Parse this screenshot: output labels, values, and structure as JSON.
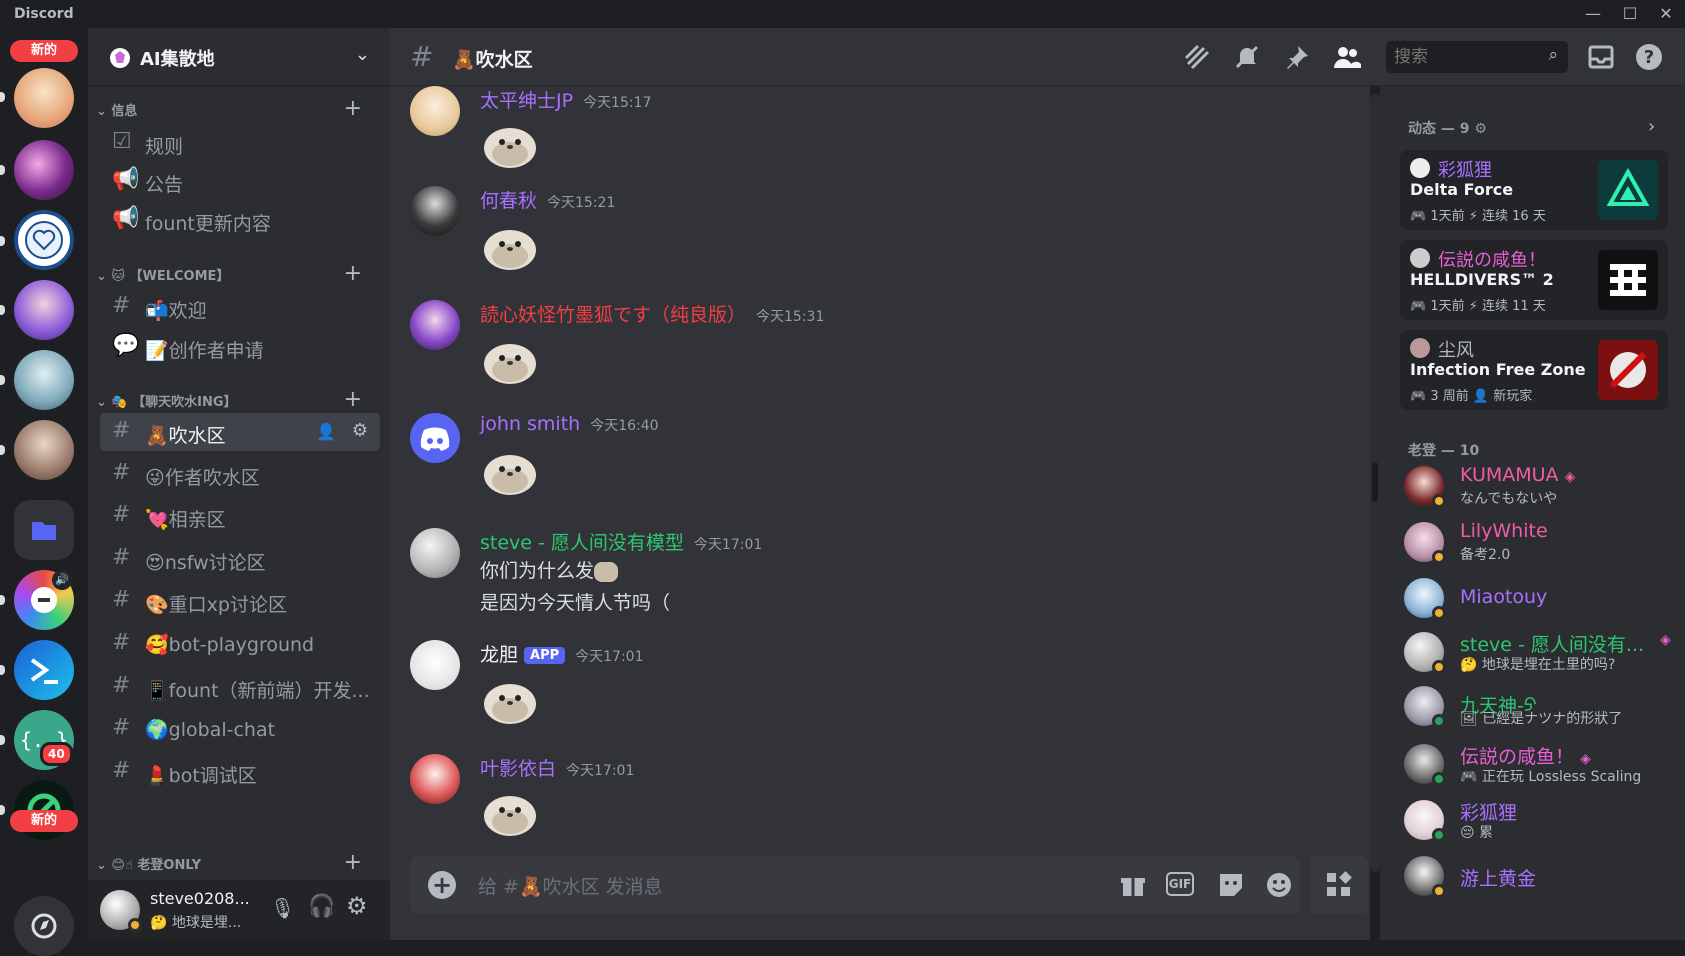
{
  "window": {
    "app_name": "Discord"
  },
  "guilds": {
    "new_badge_top": "新的",
    "new_badge_bottom": "新的",
    "unread_count": "40"
  },
  "server": {
    "name": "AI集散地"
  },
  "categories": [
    {
      "label": "信息"
    },
    {
      "label": "【WELCOME】"
    },
    {
      "label": "【聊天吹水ING】"
    },
    {
      "label": "老登ONLY"
    }
  ],
  "channels": [
    {
      "label": "规则"
    },
    {
      "label": "公告"
    },
    {
      "label": "fount更新内容"
    },
    {
      "label": "欢迎"
    },
    {
      "label": "创作者申请"
    },
    {
      "label": "吹水区"
    },
    {
      "label": "作者吹水区"
    },
    {
      "label": "相亲区"
    },
    {
      "label": "nsfw讨论区"
    },
    {
      "label": "重口xp讨论区"
    },
    {
      "label": "bot-playground"
    },
    {
      "label": "fount（新前端）开发..."
    },
    {
      "label": "global-chat"
    },
    {
      "label": "bot调试区"
    }
  ],
  "user_panel": {
    "name": "steve0208...",
    "status": "地球是埋..."
  },
  "chat": {
    "channel_name": "吹水区",
    "search_placeholder": "搜索",
    "composer_placeholder": "给 #🧸吹水区 发消息",
    "messages": [
      {
        "author": "太平绅士JP",
        "time": "今天15:17",
        "color": "#a970ff"
      },
      {
        "author": "何春秋",
        "time": "今天15:21",
        "color": "#a970ff"
      },
      {
        "author": "読心妖怪竹墨狐です（纯良版）",
        "time": "今天15:31",
        "color": "#f23f43"
      },
      {
        "author": "john smith",
        "time": "今天16:40",
        "color": "#a970ff"
      },
      {
        "author": "steve - 愿人间没有模型",
        "time": "今天17:01",
        "color": "#2dc770",
        "lines": [
          "你们为什么发",
          "是因为今天情人节吗（"
        ]
      },
      {
        "author": "龙胆",
        "time": "今天17:01",
        "color": "#f2f3f5",
        "tag": "APP"
      },
      {
        "author": "叶影依白",
        "time": "今天17:01",
        "color": "#a970ff"
      }
    ]
  },
  "members": {
    "activity_title": "动态 — 9",
    "activities": [
      {
        "user": "彩狐狸",
        "game": "Delta Force",
        "time": "1天前",
        "streak": "连续 16 天",
        "user_color": "#a970ff",
        "art_color": "#0d3b3b"
      },
      {
        "user": "伝説の咸鱼！",
        "game": "HELLDIVERS™ 2",
        "time": "1天前",
        "streak": "连续 11 天",
        "user_color": "#e85fd4",
        "art_color": "#111"
      },
      {
        "user": "尘风",
        "game": "Infection Free Zone",
        "time": "3 周前",
        "streak": "新玩家",
        "user_color": "#b5bac1",
        "art_color": "#7a1010"
      }
    ],
    "group_title": "老登 — 10",
    "list": [
      {
        "name": "KUMAMUA",
        "status": "なんでもないや",
        "color": "#f25ca6"
      },
      {
        "name": "LilyWhite",
        "status": "备考2.0",
        "color": "#f25ca6"
      },
      {
        "name": "Miaotouy",
        "status": "",
        "color": "#a970ff"
      },
      {
        "name": "steve - 愿人间没有...",
        "status": "地球是埋在土里的吗?",
        "color": "#2dc770"
      },
      {
        "name": "九天神-ᠫ",
        "status": "已經是ナツナ的形狀了",
        "color": "#2dc770"
      },
      {
        "name": "伝説の咸鱼！",
        "status": "正在玩 Lossless Scaling",
        "color": "#e85fd4"
      },
      {
        "name": "彩狐狸",
        "status": "累",
        "color": "#a970ff"
      },
      {
        "name": "游上黄金",
        "status": "",
        "color": "#a970ff"
      }
    ]
  }
}
